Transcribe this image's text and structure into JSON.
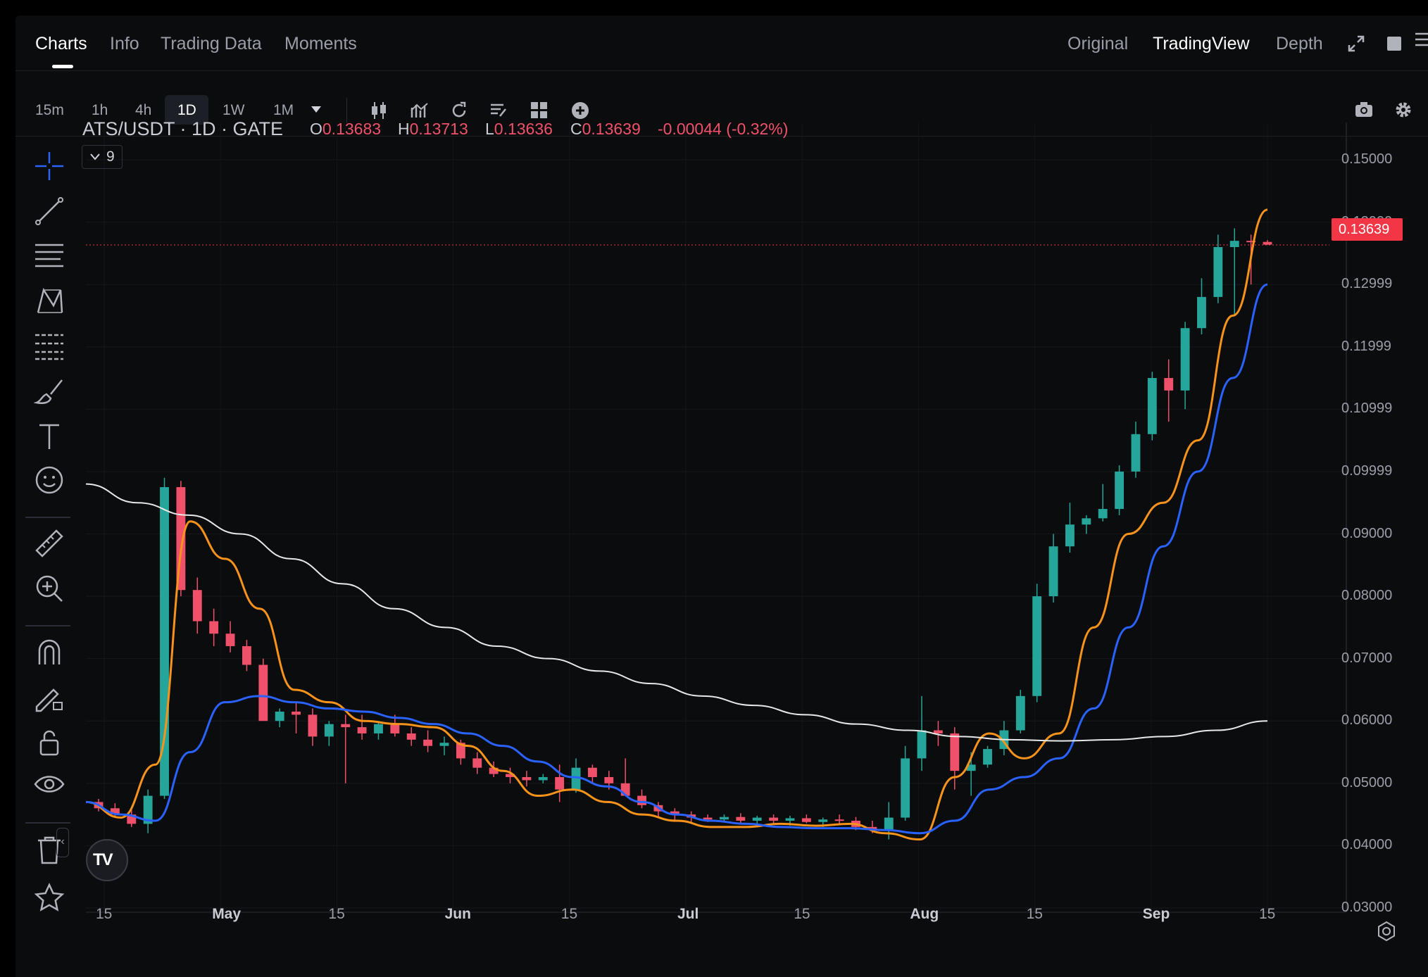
{
  "tabs": [
    {
      "label": "Charts",
      "active": true
    },
    {
      "label": "Info",
      "active": false
    },
    {
      "label": "Trading Data",
      "active": false
    },
    {
      "label": "Moments",
      "active": false
    }
  ],
  "views": [
    {
      "label": "Original",
      "active": false
    },
    {
      "label": "TradingView",
      "active": true
    },
    {
      "label": "Depth",
      "active": false
    }
  ],
  "timeframes": [
    {
      "label": "15m",
      "active": false
    },
    {
      "label": "1h",
      "active": false
    },
    {
      "label": "4h",
      "active": false
    },
    {
      "label": "1D",
      "active": true
    },
    {
      "label": "1W",
      "active": false
    },
    {
      "label": "1M",
      "active": false
    }
  ],
  "legend": {
    "symbol": "ATS/USDT · 1D · GATE",
    "open_label": "O",
    "open": "0.13683",
    "high_label": "H",
    "high": "0.13713",
    "low_label": "L",
    "low": "0.13636",
    "close_label": "C",
    "close": "0.13639",
    "change": "-0.00044 (-0.32%)",
    "indicator_count": "9"
  },
  "colors": {
    "up": "#26a69a",
    "down": "#f0516a",
    "ma_fast": "#f7931a",
    "ma_mid": "#2962ff",
    "ma_slow": "#e8e8e8",
    "price_tag": "#f23645"
  },
  "chart_data": {
    "type": "line",
    "title": "ATS/USDT · 1D · GATE",
    "y_ticks": [
      "0.15000",
      "0.13999",
      "0.12999",
      "0.11999",
      "0.10999",
      "0.09999",
      "0.09000",
      "0.08000",
      "0.07000",
      "0.06000",
      "0.05000",
      "0.04000",
      "0.03000"
    ],
    "ylim": [
      0.03,
      0.15
    ],
    "x_ticks": [
      "15",
      "May",
      "15",
      "Jun",
      "15",
      "Jul",
      "15",
      "Aug",
      "15",
      "Sep",
      "15"
    ],
    "current_price": "0.13639",
    "series": [
      {
        "values": [
          0.047,
          0.0445,
          0.053,
          0.092,
          0.086,
          0.078,
          0.065,
          0.063,
          0.06,
          0.0595,
          0.059,
          0.056,
          0.052,
          0.048,
          0.049,
          0.047,
          0.045,
          0.044,
          0.043,
          0.043,
          0.0435,
          0.0432,
          0.0435,
          0.042,
          0.041,
          0.051,
          0.058,
          0.054,
          0.058,
          0.075,
          0.09,
          0.095,
          0.105,
          0.125,
          0.142
        ]
      },
      {
        "values": [
          0.047,
          0.045,
          0.044,
          0.055,
          0.063,
          0.064,
          0.063,
          0.062,
          0.0615,
          0.0605,
          0.0595,
          0.058,
          0.056,
          0.0535,
          0.051,
          0.0495,
          0.047,
          0.045,
          0.044,
          0.0435,
          0.043,
          0.0428,
          0.0428,
          0.0425,
          0.042,
          0.044,
          0.049,
          0.051,
          0.054,
          0.062,
          0.075,
          0.088,
          0.1,
          0.115,
          0.13
        ]
      },
      {
        "values": [
          0.098,
          0.095,
          0.093,
          0.09,
          0.086,
          0.082,
          0.078,
          0.075,
          0.072,
          0.07,
          0.068,
          0.066,
          0.064,
          0.0625,
          0.061,
          0.0595,
          0.0585,
          0.0575,
          0.057,
          0.0568,
          0.057,
          0.0575,
          0.0585,
          0.06
        ]
      }
    ],
    "candles": [
      [
        0.047,
        0.0475,
        0.0455,
        0.046
      ],
      [
        0.046,
        0.0468,
        0.0445,
        0.045
      ],
      [
        0.045,
        0.046,
        0.043,
        0.0435
      ],
      [
        0.0435,
        0.049,
        0.042,
        0.048
      ],
      [
        0.048,
        0.099,
        0.0475,
        0.0975
      ],
      [
        0.0975,
        0.0985,
        0.08,
        0.081
      ],
      [
        0.081,
        0.083,
        0.074,
        0.076
      ],
      [
        0.076,
        0.078,
        0.072,
        0.074
      ],
      [
        0.074,
        0.076,
        0.071,
        0.072
      ],
      [
        0.072,
        0.073,
        0.068,
        0.069
      ],
      [
        0.069,
        0.07,
        0.065,
        0.06
      ],
      [
        0.06,
        0.062,
        0.059,
        0.0615
      ],
      [
        0.0615,
        0.063,
        0.058,
        0.061
      ],
      [
        0.061,
        0.062,
        0.056,
        0.0575
      ],
      [
        0.0575,
        0.06,
        0.056,
        0.0595
      ],
      [
        0.0595,
        0.061,
        0.05,
        0.059
      ],
      [
        0.059,
        0.061,
        0.057,
        0.058
      ],
      [
        0.058,
        0.06,
        0.057,
        0.0595
      ],
      [
        0.0595,
        0.061,
        0.0575,
        0.058
      ],
      [
        0.058,
        0.059,
        0.056,
        0.057
      ],
      [
        0.057,
        0.0585,
        0.055,
        0.056
      ],
      [
        0.056,
        0.0575,
        0.0545,
        0.0565
      ],
      [
        0.0565,
        0.057,
        0.053,
        0.054
      ],
      [
        0.054,
        0.055,
        0.0515,
        0.0525
      ],
      [
        0.0525,
        0.0535,
        0.051,
        0.0515
      ],
      [
        0.0515,
        0.0525,
        0.05,
        0.051
      ],
      [
        0.051,
        0.052,
        0.0495,
        0.0505
      ],
      [
        0.0505,
        0.0515,
        0.05,
        0.051
      ],
      [
        0.051,
        0.053,
        0.047,
        0.049
      ],
      [
        0.049,
        0.054,
        0.0485,
        0.0525
      ],
      [
        0.0525,
        0.053,
        0.05,
        0.051
      ],
      [
        0.051,
        0.052,
        0.049,
        0.05
      ],
      [
        0.05,
        0.054,
        0.048,
        0.048
      ],
      [
        0.048,
        0.049,
        0.046,
        0.0465
      ],
      [
        0.0465,
        0.047,
        0.0445,
        0.0455
      ],
      [
        0.0455,
        0.046,
        0.044,
        0.045
      ],
      [
        0.045,
        0.0455,
        0.0435,
        0.0445
      ],
      [
        0.0445,
        0.045,
        0.0438,
        0.0442
      ],
      [
        0.0442,
        0.045,
        0.0438,
        0.0446
      ],
      [
        0.0446,
        0.0452,
        0.0435,
        0.044
      ],
      [
        0.044,
        0.0448,
        0.043,
        0.0445
      ],
      [
        0.0445,
        0.045,
        0.0436,
        0.044
      ],
      [
        0.044,
        0.0448,
        0.0432,
        0.0444
      ],
      [
        0.0444,
        0.045,
        0.0436,
        0.0438
      ],
      [
        0.0438,
        0.0445,
        0.043,
        0.0442
      ],
      [
        0.0442,
        0.045,
        0.0436,
        0.044
      ],
      [
        0.044,
        0.0446,
        0.0425,
        0.043
      ],
      [
        0.043,
        0.044,
        0.042,
        0.0425
      ],
      [
        0.0425,
        0.047,
        0.041,
        0.0445
      ],
      [
        0.0445,
        0.056,
        0.044,
        0.054
      ],
      [
        0.054,
        0.064,
        0.052,
        0.0585
      ],
      [
        0.0585,
        0.06,
        0.056,
        0.058
      ],
      [
        0.058,
        0.059,
        0.049,
        0.052
      ],
      [
        0.052,
        0.055,
        0.048,
        0.053
      ],
      [
        0.053,
        0.056,
        0.0525,
        0.0555
      ],
      [
        0.0555,
        0.06,
        0.0545,
        0.0585
      ],
      [
        0.0585,
        0.065,
        0.058,
        0.064
      ],
      [
        0.064,
        0.082,
        0.063,
        0.08
      ],
      [
        0.08,
        0.09,
        0.079,
        0.088
      ],
      [
        0.088,
        0.095,
        0.087,
        0.0915
      ],
      [
        0.0915,
        0.093,
        0.09,
        0.0925
      ],
      [
        0.0925,
        0.098,
        0.092,
        0.094
      ],
      [
        0.094,
        0.101,
        0.093,
        0.1
      ],
      [
        0.1,
        0.108,
        0.099,
        0.106
      ],
      [
        0.106,
        0.116,
        0.105,
        0.115
      ],
      [
        0.115,
        0.118,
        0.108,
        0.113
      ],
      [
        0.113,
        0.124,
        0.11,
        0.123
      ],
      [
        0.123,
        0.131,
        0.122,
        0.128
      ],
      [
        0.128,
        0.138,
        0.127,
        0.136
      ],
      [
        0.136,
        0.139,
        0.125,
        0.137
      ],
      [
        0.137,
        0.138,
        0.13,
        0.1368
      ],
      [
        0.13683,
        0.13713,
        0.13636,
        0.13639
      ]
    ]
  }
}
